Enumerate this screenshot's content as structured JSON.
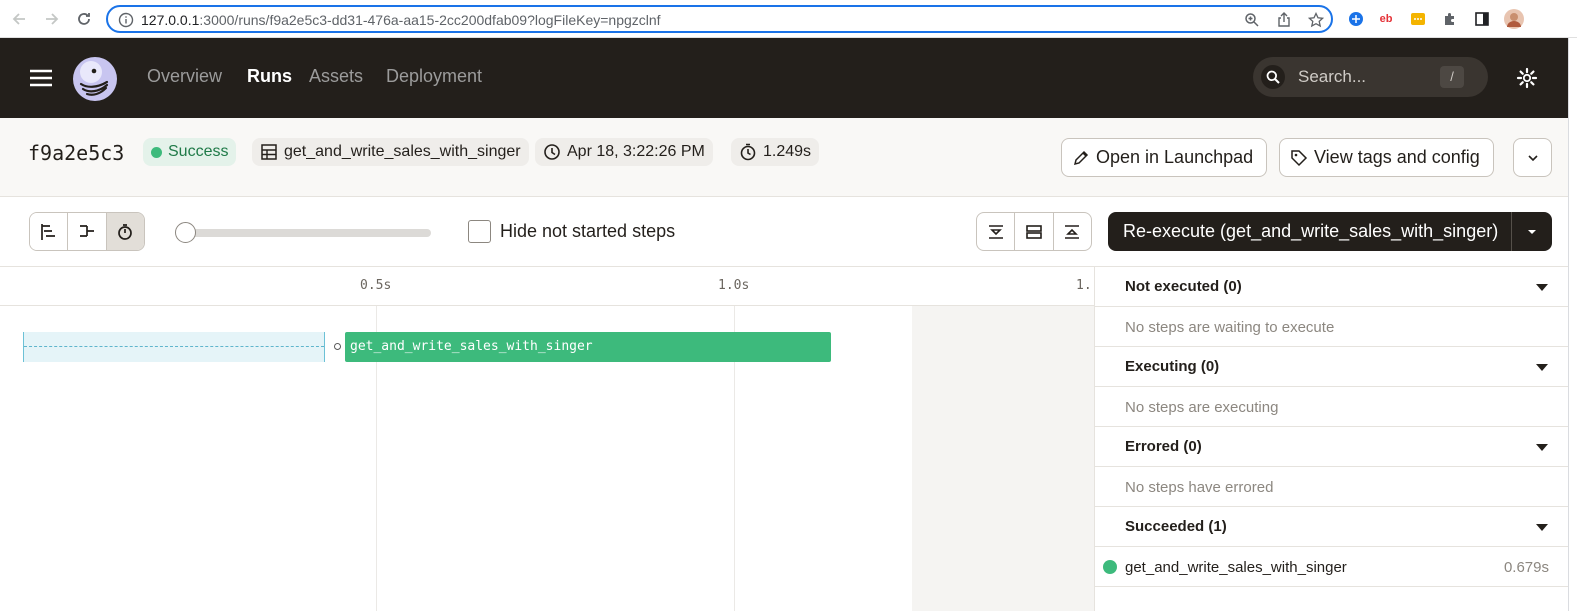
{
  "browser": {
    "url_host": "127.0.0.1",
    "url_rest": ":3000/runs/f9a2e5c3-dd31-476a-aa15-2cc200dfab09?logFileKey=npgzclnf",
    "ext_ebay": "eb"
  },
  "app": {
    "nav": [
      "Overview",
      "Runs",
      "Assets",
      "Deployment"
    ],
    "active_nav": "Runs",
    "search_placeholder": "Search...",
    "search_shortcut": "/"
  },
  "run": {
    "id": "f9a2e5c3",
    "status": "Success",
    "job": "get_and_write_sales_with_singer",
    "started": "Apr 18, 3:22:26 PM",
    "duration": "1.249s",
    "open_launchpad": "Open in Launchpad",
    "view_tags": "View tags and config"
  },
  "toolbar": {
    "hide_not_started": "Hide not started steps",
    "reexecute_label": "Re-execute (get_and_write_sales_with_singer)"
  },
  "gantt": {
    "ticks": [
      "0.5s",
      "1.0s",
      "1."
    ],
    "step_label": "get_and_write_sales_with_singer"
  },
  "panel": {
    "sections": [
      {
        "title": "Not executed (0)",
        "empty": "No steps are waiting to execute"
      },
      {
        "title": "Executing (0)",
        "empty": "No steps are executing"
      },
      {
        "title": "Errored (0)",
        "empty": "No steps have errored"
      },
      {
        "title": "Succeeded (1)",
        "step": "get_and_write_sales_with_singer",
        "duration": "0.679s"
      }
    ]
  },
  "colors": {
    "header_bg": "#231f1b",
    "success_green": "#3dba7c",
    "waiting_blue": "#e5f4f8",
    "url_focus": "#1a73e8"
  }
}
